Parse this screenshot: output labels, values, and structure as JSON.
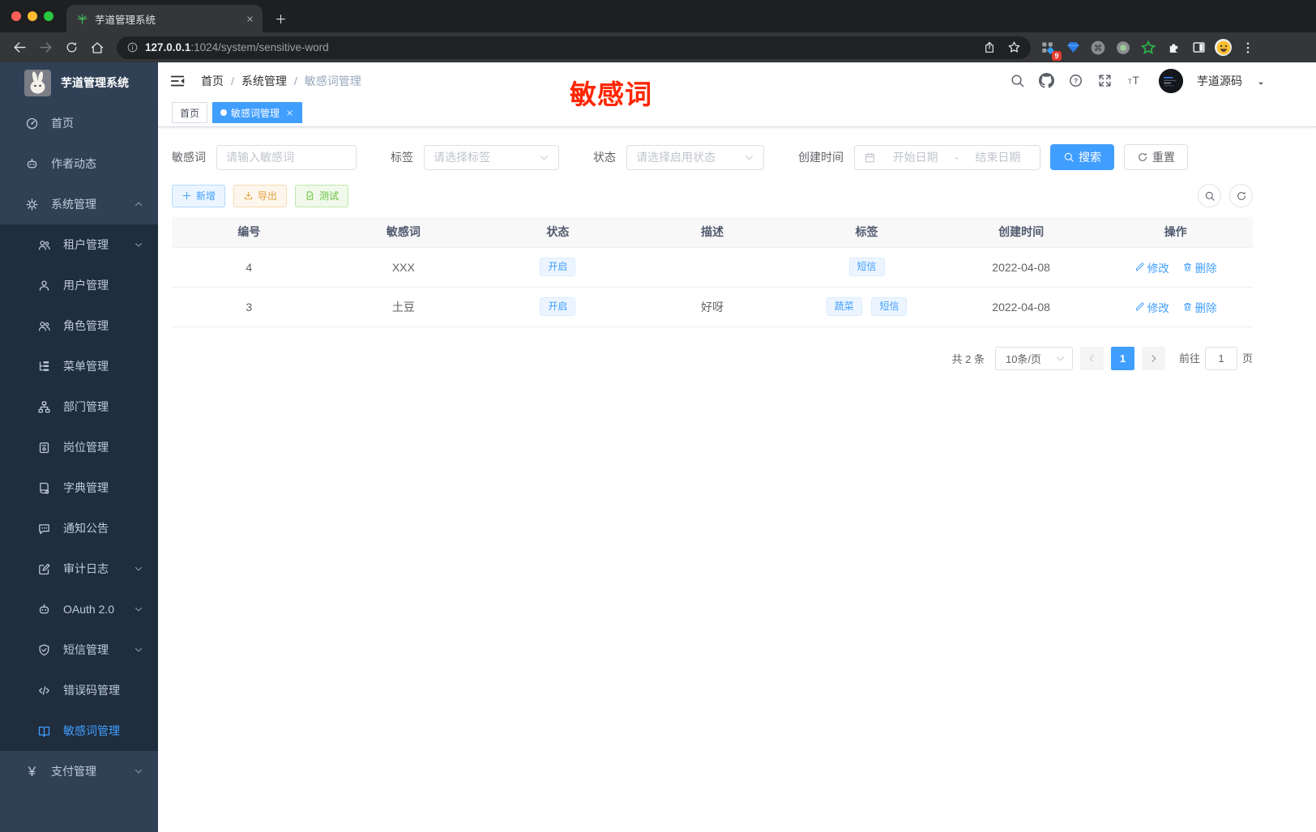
{
  "browser": {
    "tab_title": "芋道管理系统",
    "url": {
      "host": "127.0.0.1",
      "rest": ":1024/system/sensitive-word"
    },
    "extension_badge": "9"
  },
  "sidebar": {
    "title": "芋道管理系统",
    "items": [
      {
        "label": "首页",
        "icon": "dashboard-icon"
      },
      {
        "label": "作者动态",
        "icon": "author-icon"
      },
      {
        "label": "系统管理",
        "icon": "gear-icon",
        "chevron": "up"
      },
      {
        "label": "租户管理",
        "icon": "tenant-icon",
        "chevron": "down"
      },
      {
        "label": "用户管理",
        "icon": "user-icon"
      },
      {
        "label": "角色管理",
        "icon": "role-icon"
      },
      {
        "label": "菜单管理",
        "icon": "menu-tree-icon"
      },
      {
        "label": "部门管理",
        "icon": "dept-icon"
      },
      {
        "label": "岗位管理",
        "icon": "post-icon"
      },
      {
        "label": "字典管理",
        "icon": "dict-icon"
      },
      {
        "label": "通知公告",
        "icon": "notice-icon"
      },
      {
        "label": "审计日志",
        "icon": "audit-log-icon",
        "chevron": "down"
      },
      {
        "label": "OAuth 2.0",
        "icon": "oauth-icon",
        "chevron": "down"
      },
      {
        "label": "短信管理",
        "icon": "sms-shield-icon",
        "chevron": "down"
      },
      {
        "label": "错误码管理",
        "icon": "error-code-icon"
      },
      {
        "label": "敏感词管理",
        "icon": "sensitive-word-icon",
        "active": true
      },
      {
        "label": "支付管理",
        "icon": "pay-icon",
        "chevron": "down"
      }
    ]
  },
  "navbar": {
    "breadcrumb": [
      "首页",
      "系统管理",
      "敏感词管理"
    ],
    "separator": "/",
    "username": "芋道源码"
  },
  "overlay": {
    "text": "敏感词",
    "color": "#ff2600"
  },
  "tags_view": {
    "tabs": [
      {
        "label": "首页",
        "active": false
      },
      {
        "label": "敏感词管理",
        "active": true
      }
    ]
  },
  "filters": {
    "keyword": {
      "label": "敏感词",
      "placeholder": "请输入敏感词"
    },
    "tag": {
      "label": "标签",
      "placeholder": "请选择标签"
    },
    "status": {
      "label": "状态",
      "placeholder": "请选择启用状态"
    },
    "create_time": {
      "label": "创建时间",
      "start_placeholder": "开始日期",
      "separator": "-",
      "end_placeholder": "结束日期"
    },
    "search_label": "搜索",
    "reset_label": "重置"
  },
  "toolbar": {
    "add_label": "新增",
    "export_label": "导出",
    "test_label": "测试"
  },
  "table": {
    "columns": [
      "编号",
      "敏感词",
      "状态",
      "描述",
      "标签",
      "创建时间",
      "操作"
    ],
    "rows": [
      {
        "id": "4",
        "word": "XXX",
        "status": "开启",
        "description": "",
        "tags": [
          "短信"
        ],
        "created": "2022-04-08",
        "edit_label": "修改",
        "delete_label": "删除"
      },
      {
        "id": "3",
        "word": "土豆",
        "status": "开启",
        "description": "好呀",
        "tags": [
          "蔬菜",
          "短信"
        ],
        "created": "2022-04-08",
        "edit_label": "修改",
        "delete_label": "删除"
      }
    ]
  },
  "pagination": {
    "total": "共 2 条",
    "page_size": "10条/页",
    "current_page": "1",
    "goto_label": "前往",
    "goto_value": "1",
    "page_unit": "页"
  },
  "colors": {
    "primary": "#409eff",
    "sidebar_bg": "#304156",
    "submenu_bg": "#1f2d3d",
    "warning": "#e6a23c",
    "success": "#67c23a",
    "overlay_red": "#ff2600"
  }
}
